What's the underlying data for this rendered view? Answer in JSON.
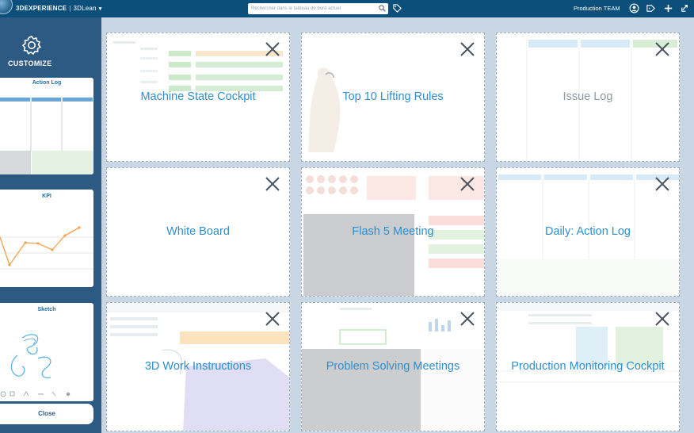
{
  "topbar": {
    "brand": "3DEXPERIENCE",
    "app": "3DLean",
    "search_placeholder": "Rechercher dans le tableau de bord actuel",
    "user": "Production TEAM",
    "icons": [
      "compass-logo",
      "search-icon",
      "tag-icon",
      "user-icon",
      "share-icon",
      "add-icon",
      "help-icon"
    ]
  },
  "sidebar": {
    "title": "CUSTOMIZE",
    "icon": "gear-icon",
    "cards": [
      {
        "label": "Action Log"
      },
      {
        "label": "KPI"
      },
      {
        "label": "Sketch"
      }
    ],
    "close_label": "Close"
  },
  "tiles": [
    {
      "label": "Machine State Cockpit"
    },
    {
      "label": "Top 10 Lifting Rules"
    },
    {
      "label": "Issue Log"
    },
    {
      "label": "White Board"
    },
    {
      "label": "Flash 5 Meeting"
    },
    {
      "label": "Daily: Action Log"
    },
    {
      "label": "3D Work Instructions"
    },
    {
      "label": "Problem Solving Meetings"
    },
    {
      "label": "Production Monitoring Cockpit"
    }
  ],
  "colors": {
    "topbar": "#0b4f7a",
    "sidebar": "#2d5a82",
    "workspace": "#c9d6e3",
    "tile_title": "#2f8fd0"
  }
}
